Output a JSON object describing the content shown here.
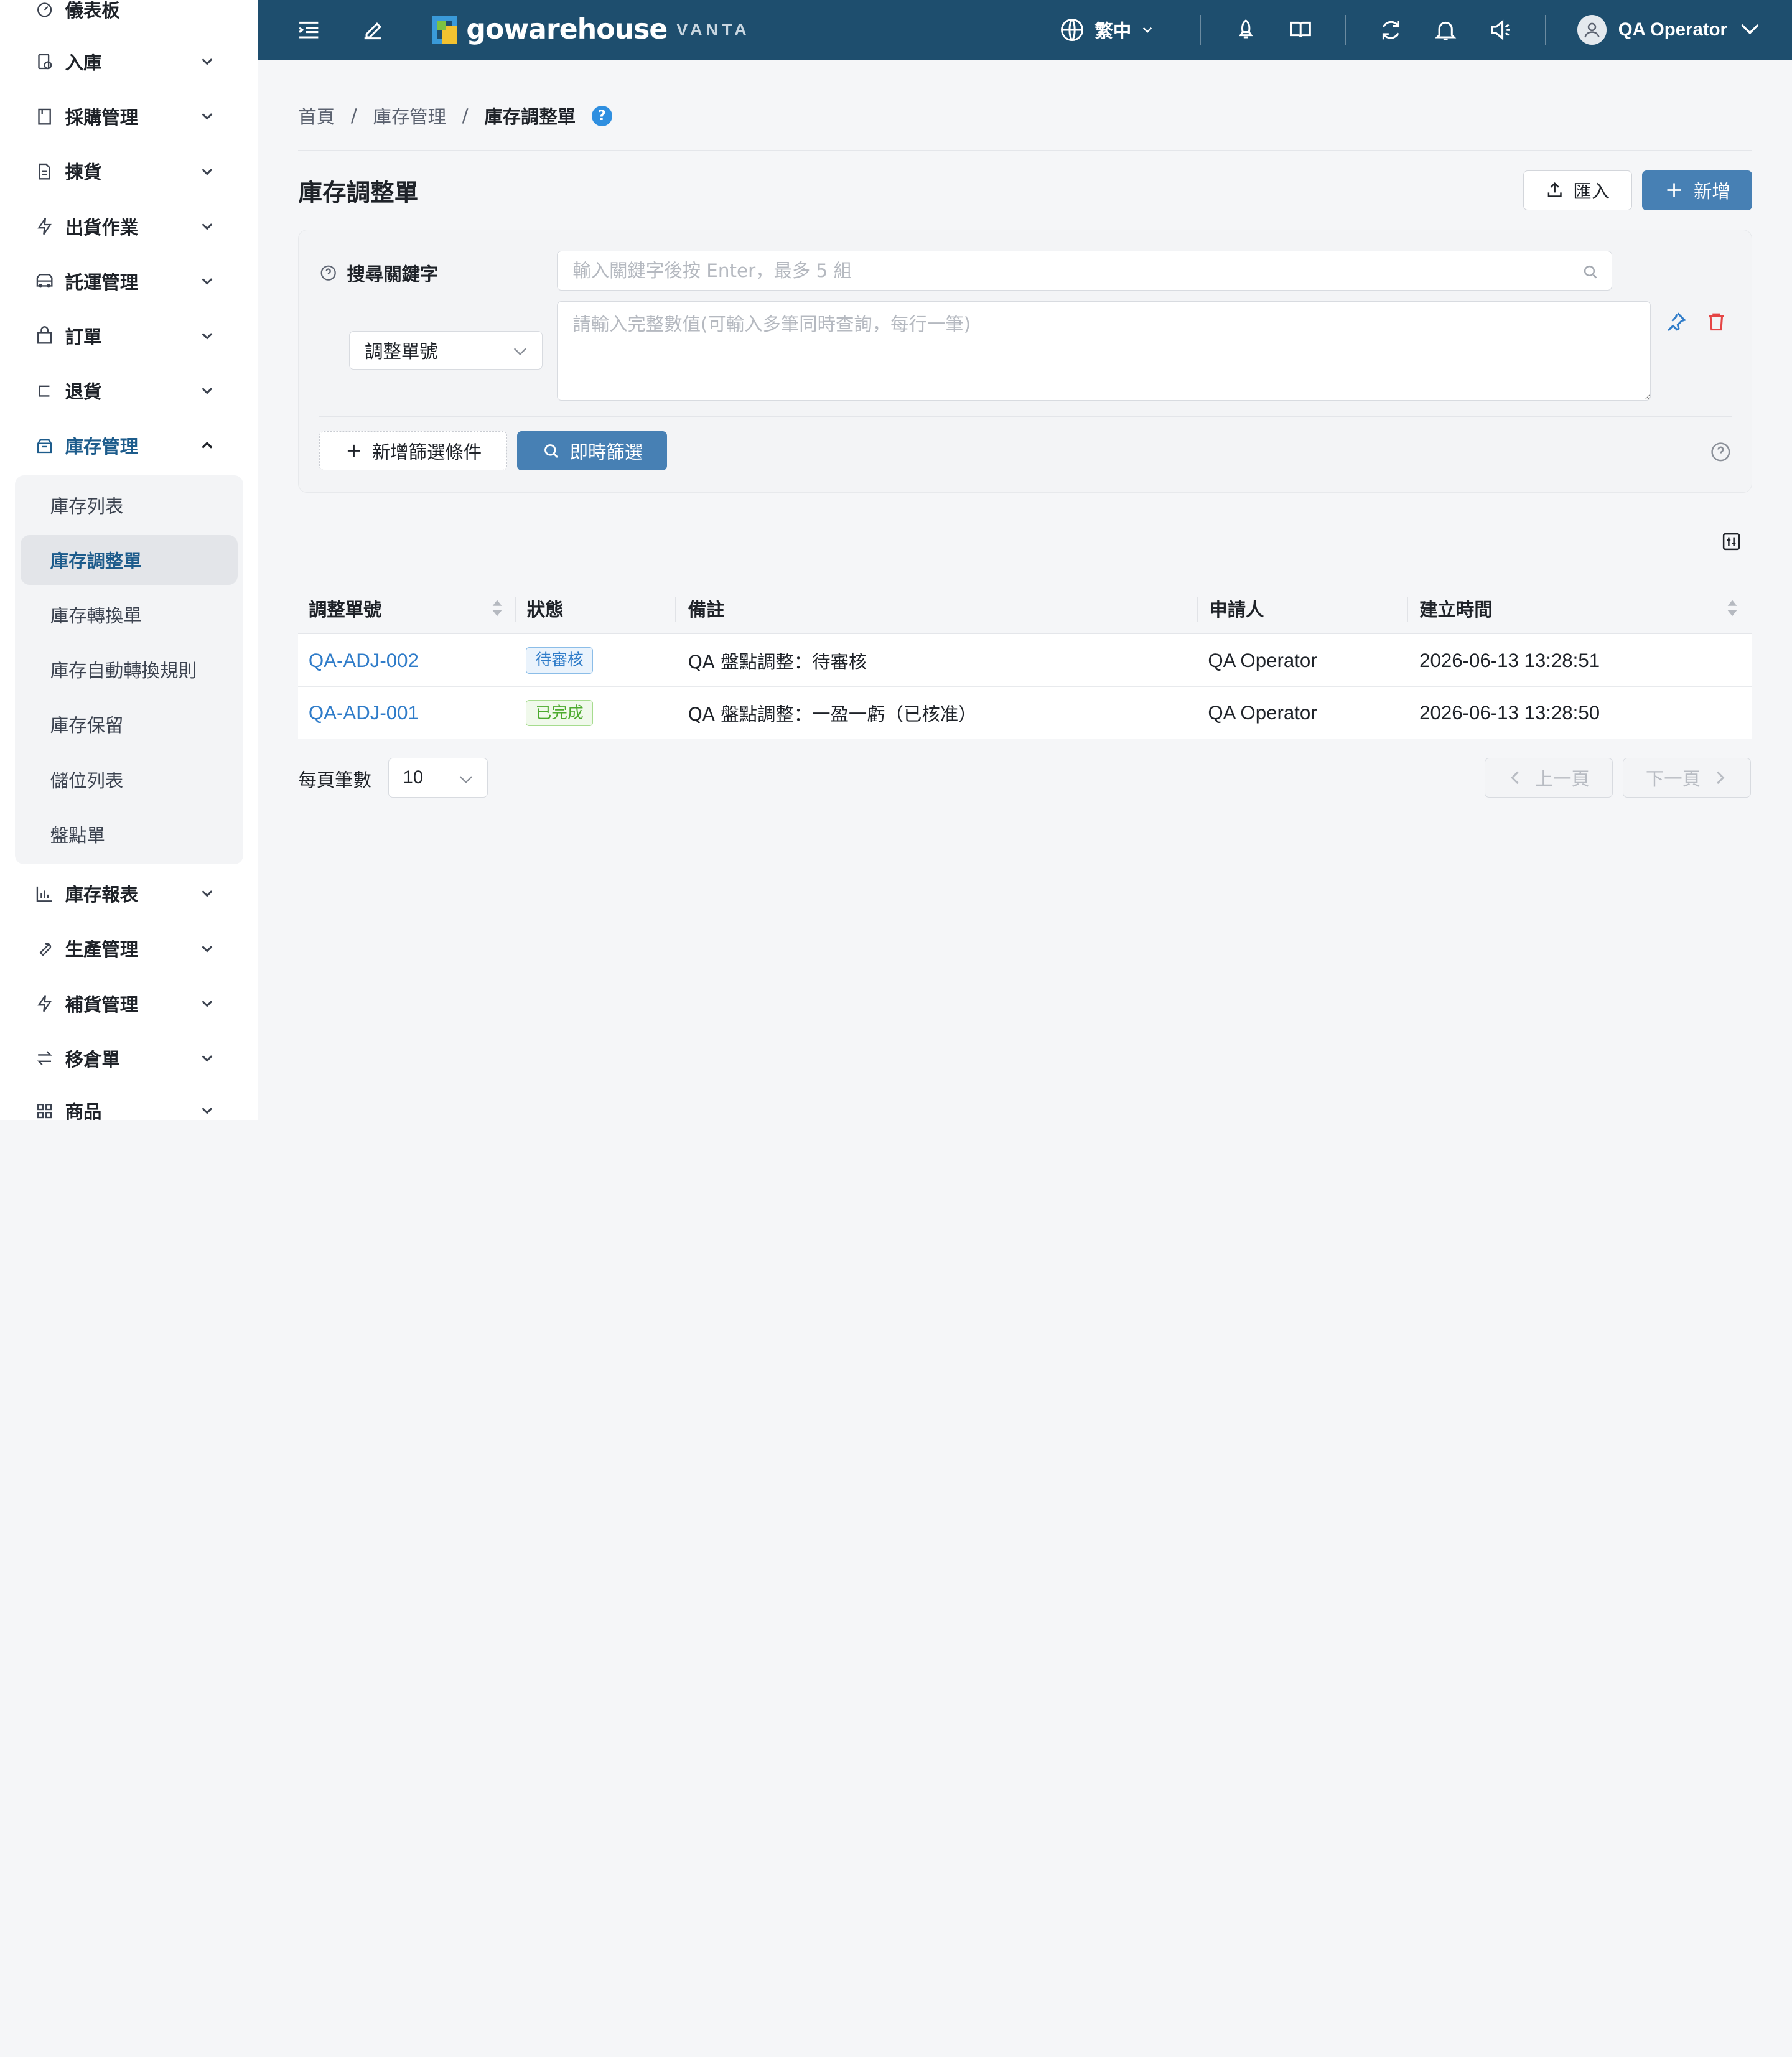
{
  "app": {
    "brand": "gowarehouse",
    "brand_suffix": "VANTA",
    "language": "繁中",
    "user_name": "QA Operator"
  },
  "sidebar": {
    "items": [
      {
        "label": "儀表板",
        "icon": "dashboard-icon"
      },
      {
        "label": "入庫",
        "icon": "inbound-icon"
      },
      {
        "label": "採購管理",
        "icon": "purchase-icon"
      },
      {
        "label": "揀貨",
        "icon": "picking-icon"
      },
      {
        "label": "出貨作業",
        "icon": "shipping-icon"
      },
      {
        "label": "託運管理",
        "icon": "truck-icon"
      },
      {
        "label": "訂單",
        "icon": "bag-icon"
      },
      {
        "label": "退貨",
        "icon": "return-icon"
      },
      {
        "label": "庫存管理",
        "icon": "inventory-icon"
      },
      {
        "label": "庫存報表",
        "icon": "chart-icon"
      },
      {
        "label": "生產管理",
        "icon": "wrench-icon"
      },
      {
        "label": "補貨管理",
        "icon": "bolt-icon"
      },
      {
        "label": "移倉單",
        "icon": "transfer-icon"
      },
      {
        "label": "商品",
        "icon": "grid-icon"
      }
    ],
    "sub_items": [
      "庫存列表",
      "庫存調整單",
      "庫存轉換單",
      "庫存自動轉換規則",
      "庫存保留",
      "儲位列表",
      "盤點單"
    ]
  },
  "breadcrumb": {
    "home": "首頁",
    "parent": "庫存管理",
    "current": "庫存調整單",
    "help": "?"
  },
  "page": {
    "title": "庫存調整單",
    "import_label": "匯入",
    "create_label": "新增"
  },
  "filter": {
    "keyword_label": "搜尋關鍵字",
    "keyword_placeholder": "輸入關鍵字後按 Enter，最多 5 組",
    "field_select": "調整單號",
    "values_placeholder": "請輸入完整數值(可輸入多筆同時查詢，每行一筆)",
    "add_condition_label": "新增篩選條件",
    "search_label": "即時篩選"
  },
  "table": {
    "columns": [
      "調整單號",
      "狀態",
      "備註",
      "申請人",
      "建立時間"
    ],
    "rows": [
      {
        "id": "QA-ADJ-002",
        "status": "待審核",
        "note": "QA 盤點調整：待審核",
        "applicant": "QA Operator",
        "created": "2026-06-13 13:28:51"
      },
      {
        "id": "QA-ADJ-001",
        "status": "已完成",
        "note": "QA 盤點調整：一盈一虧（已核准）",
        "applicant": "QA Operator",
        "created": "2026-06-13 13:28:50"
      }
    ]
  },
  "pagination": {
    "page_size_label": "每頁筆數",
    "page_size": "10",
    "prev_label": "上一頁",
    "next_label": "下一頁"
  },
  "colors": {
    "topbar": "#1e4e6e",
    "primary": "#4780b4",
    "link": "#2f7cc9",
    "success": "#4caa2e"
  }
}
